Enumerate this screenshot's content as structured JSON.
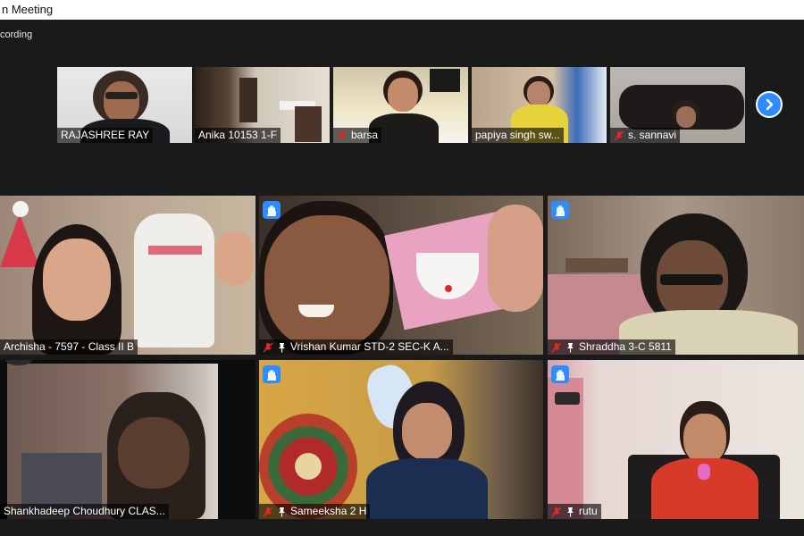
{
  "window": {
    "title": "n Meeting"
  },
  "recording": {
    "label": "cording"
  },
  "strip": {
    "participants": [
      {
        "name": "RAJASHREE RAY",
        "muted": false
      },
      {
        "name": "Anika 10153 1-F",
        "muted": false
      },
      {
        "name": "barsa",
        "muted": true
      },
      {
        "name": "papiya singh sw...",
        "muted": false
      },
      {
        "name": "s. sannavi",
        "muted": true
      }
    ],
    "next_icon": "chevron-right-icon"
  },
  "grid": {
    "participants": [
      {
        "name": "Archisha - 7597 - Class II B",
        "muted": false,
        "pinned": false,
        "hand_raised": false
      },
      {
        "name": "Vrishan Kumar STD-2 SEC-K A...",
        "muted": true,
        "pinned": true,
        "hand_raised": true
      },
      {
        "name": "Shraddha 3-C 5811",
        "muted": true,
        "pinned": true,
        "hand_raised": true
      },
      {
        "name": "Shankhadeep Choudhury  CLAS...",
        "muted": false,
        "pinned": false,
        "hand_raised": false
      },
      {
        "name": "Sameeksha 2 H",
        "muted": true,
        "pinned": true,
        "hand_raised": true
      },
      {
        "name": "rutu",
        "muted": true,
        "pinned": true,
        "hand_raised": true
      }
    ]
  },
  "colors": {
    "accent": "#2d8cff",
    "mute": "#e02828",
    "background": "#1a1a1a"
  }
}
